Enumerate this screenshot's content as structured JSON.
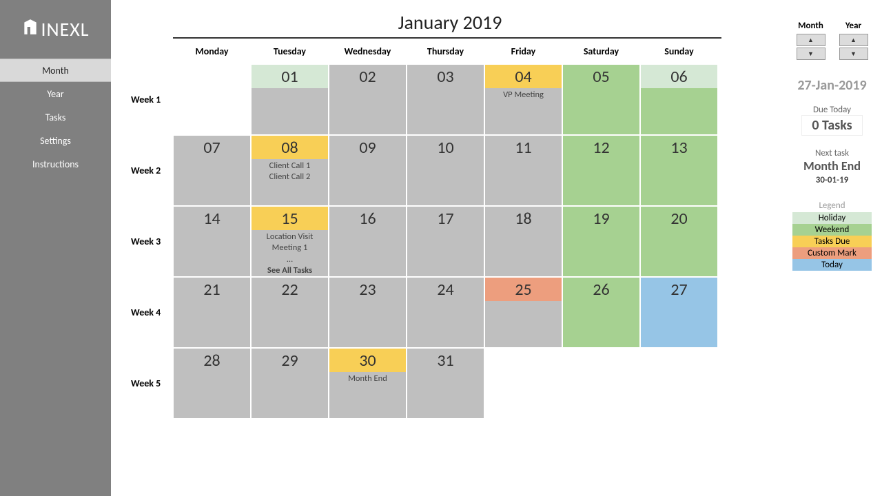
{
  "brand": "INEXL",
  "sidebar": {
    "items": [
      {
        "label": "Month",
        "active": true
      },
      {
        "label": "Year",
        "active": false
      },
      {
        "label": "Tasks",
        "active": false
      },
      {
        "label": "Settings",
        "active": false
      },
      {
        "label": "Instructions",
        "active": false
      }
    ]
  },
  "title": "January 2019",
  "day_headers": [
    "Monday",
    "Tuesday",
    "Wednesday",
    "Thursday",
    "Friday",
    "Saturday",
    "Sunday"
  ],
  "week_labels": [
    "Week 1",
    "Week 2",
    "Week 3",
    "Week 4",
    "Week 5"
  ],
  "see_all": "See All Tasks",
  "ellipsis": "...",
  "weeks": [
    [
      {
        "num": "",
        "type": "empty"
      },
      {
        "num": "01",
        "type": "holiday"
      },
      {
        "num": "02",
        "type": "normal"
      },
      {
        "num": "03",
        "type": "normal"
      },
      {
        "num": "04",
        "type": "task",
        "tasks": [
          "VP Meeting"
        ]
      },
      {
        "num": "05",
        "type": "weekend"
      },
      {
        "num": "06",
        "type": "holiday-weekend"
      }
    ],
    [
      {
        "num": "07",
        "type": "normal"
      },
      {
        "num": "08",
        "type": "task",
        "tasks": [
          "Client Call 1",
          "Client Call 2"
        ]
      },
      {
        "num": "09",
        "type": "normal"
      },
      {
        "num": "10",
        "type": "normal"
      },
      {
        "num": "11",
        "type": "normal"
      },
      {
        "num": "12",
        "type": "weekend"
      },
      {
        "num": "13",
        "type": "weekend"
      }
    ],
    [
      {
        "num": "14",
        "type": "normal"
      },
      {
        "num": "15",
        "type": "task",
        "tasks": [
          "Location Visit",
          "Meeting 1"
        ],
        "more": true
      },
      {
        "num": "16",
        "type": "normal"
      },
      {
        "num": "17",
        "type": "normal"
      },
      {
        "num": "18",
        "type": "normal"
      },
      {
        "num": "19",
        "type": "weekend"
      },
      {
        "num": "20",
        "type": "weekend"
      }
    ],
    [
      {
        "num": "21",
        "type": "normal"
      },
      {
        "num": "22",
        "type": "normal"
      },
      {
        "num": "23",
        "type": "normal"
      },
      {
        "num": "24",
        "type": "normal"
      },
      {
        "num": "25",
        "type": "custom"
      },
      {
        "num": "26",
        "type": "weekend"
      },
      {
        "num": "27",
        "type": "today"
      }
    ],
    [
      {
        "num": "28",
        "type": "normal"
      },
      {
        "num": "29",
        "type": "normal"
      },
      {
        "num": "30",
        "type": "task",
        "tasks": [
          "Month End"
        ]
      },
      {
        "num": "31",
        "type": "normal"
      },
      {
        "num": "",
        "type": "empty"
      },
      {
        "num": "",
        "type": "empty"
      },
      {
        "num": "",
        "type": "empty"
      }
    ]
  ],
  "stepper": {
    "month": "Month",
    "year": "Year"
  },
  "current_date": "27-Jan-2019",
  "due_today_label": "Due Today",
  "due_today_count": "0 Tasks",
  "next_task_label": "Next task",
  "next_task_name": "Month End",
  "next_task_date": "30-01-19",
  "legend": {
    "title": "Legend",
    "rows": [
      {
        "label": "Holiday",
        "cls": "c-holiday"
      },
      {
        "label": "Weekend",
        "cls": "c-weekend"
      },
      {
        "label": "Tasks Due",
        "cls": "c-task"
      },
      {
        "label": "Custom Mark",
        "cls": "c-custom"
      },
      {
        "label": "Today",
        "cls": "c-today"
      }
    ]
  }
}
